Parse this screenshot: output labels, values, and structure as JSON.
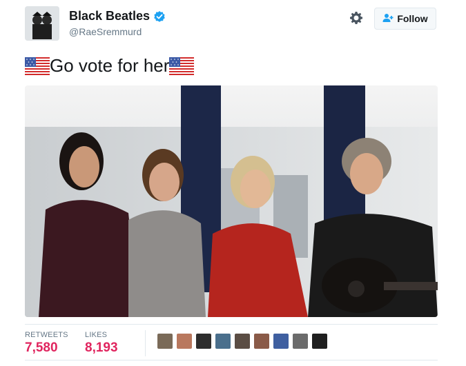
{
  "user": {
    "display_name": "Black Beatles",
    "handle": "@RaeSremmurd",
    "verified": true,
    "avatar_icon": "profile-avatar"
  },
  "actions": {
    "follow_label": "Follow",
    "settings_icon": "gear-icon"
  },
  "tweet": {
    "text": "Go vote for her",
    "leading_emoji": "us-flag",
    "trailing_emoji": "us-flag"
  },
  "media": {
    "type": "video-still",
    "description_icon": "airplane-cabin-video"
  },
  "stats": {
    "retweets_label": "RETWEETS",
    "retweets_value": "7,580",
    "likes_label": "LIKES",
    "likes_value": "8,193",
    "liker_avatars": [
      "liker-1",
      "liker-2",
      "liker-3",
      "liker-4",
      "liker-5",
      "liker-6",
      "liker-7",
      "liker-8",
      "liker-9"
    ]
  },
  "colors": {
    "accent": "#1da1f2",
    "likes_count": "#e0245e",
    "muted_text": "#657786",
    "border": "#e1e8ed"
  }
}
